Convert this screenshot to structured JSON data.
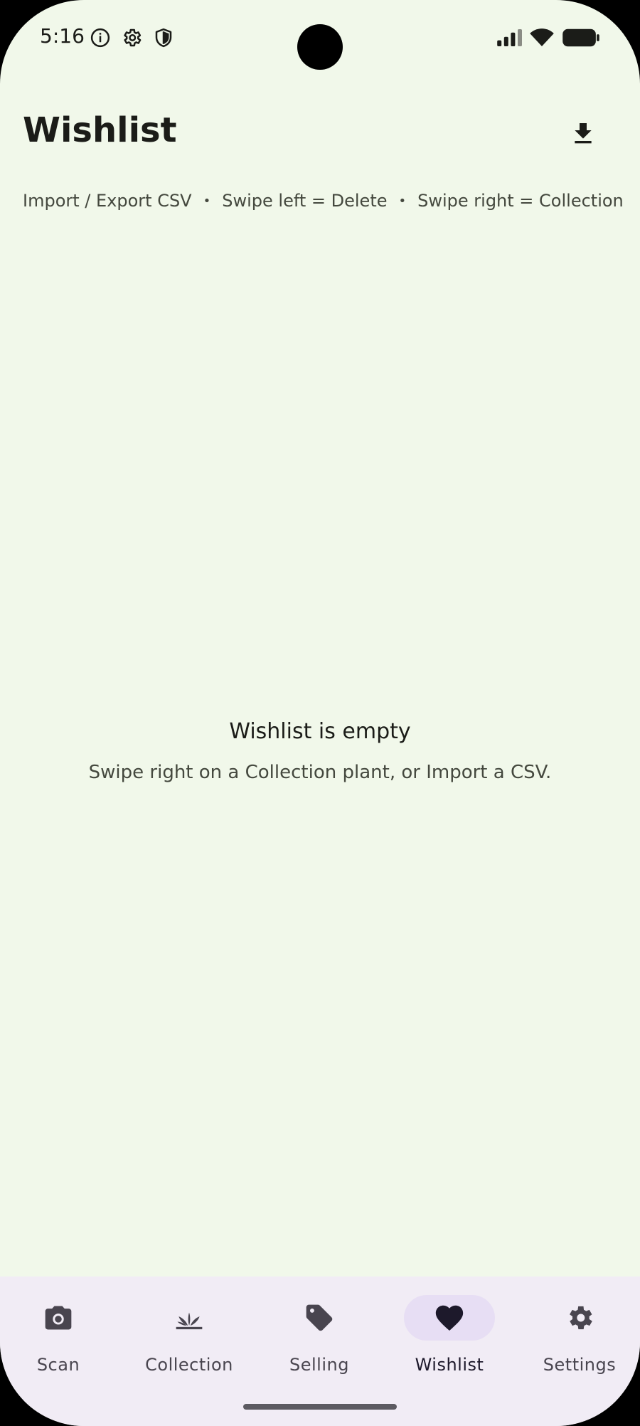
{
  "status_bar": {
    "time": "5:16",
    "left_icons": [
      "info-icon",
      "gear-icon",
      "shield-icon"
    ],
    "right_icons": [
      "signal-icon",
      "wifi-icon",
      "battery-icon"
    ]
  },
  "header": {
    "title": "Wishlist",
    "action_icon": "download-icon"
  },
  "hints": {
    "import_export": "Import / Export CSV",
    "separator": "•",
    "swipe_left": "Swipe left = Delete",
    "swipe_right": "Swipe right = Collection"
  },
  "empty_state": {
    "title": "Wishlist is empty",
    "subtitle": "Swipe right on a Collection plant, or Import a CSV."
  },
  "nav": {
    "items": [
      {
        "label": "Scan",
        "icon": "camera-icon"
      },
      {
        "label": "Collection",
        "icon": "plant-icon"
      },
      {
        "label": "Selling",
        "icon": "tag-icon"
      },
      {
        "label": "Wishlist",
        "icon": "heart-icon",
        "active": true
      },
      {
        "label": "Settings",
        "icon": "gear-icon"
      }
    ]
  },
  "colors": {
    "background": "#f1f8ea",
    "nav_background": "#f1ecf5",
    "active_pill": "#e7def4",
    "icon": "#49454f"
  }
}
